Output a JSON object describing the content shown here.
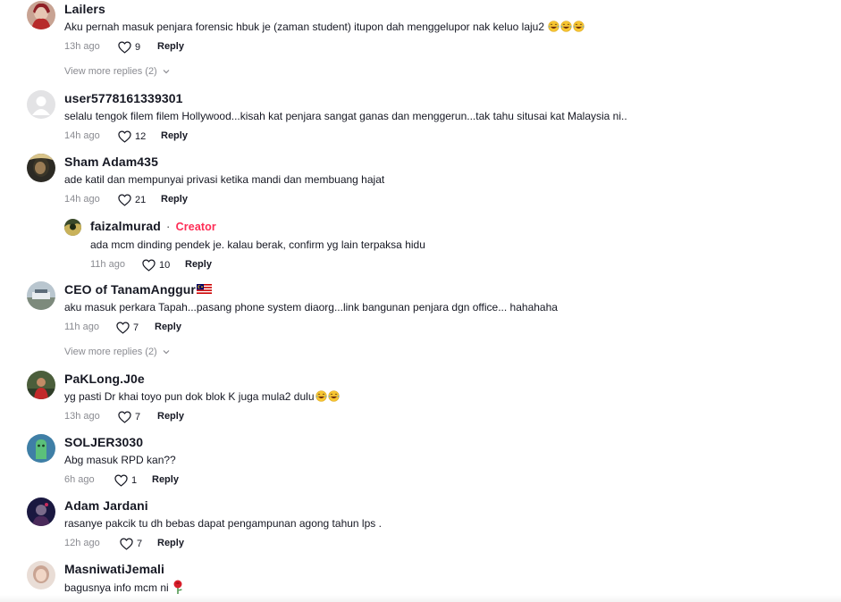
{
  "icons": {
    "like": "heart-outline-icon",
    "chevron": "chevron-down-icon",
    "laugh": "face-with-tears-of-joy-emoji",
    "flag": "malaysia-flag-emoji",
    "rose": "rose-emoji"
  },
  "colors": {
    "creator": "#fe2c55",
    "meta": "#8a8b91",
    "text": "#161823"
  },
  "comments": [
    {
      "username": "Lailers",
      "text": "Aku pernah masuk penjara forensic hbuk je (zaman student) itupon dah menggelupor nak keluo laju2",
      "time": "13h ago",
      "likes": "9",
      "reply_label": "Reply",
      "view_more": "View more replies (2)"
    },
    {
      "username": "user5778161339301",
      "text": "selalu tengok filem filem Hollywood...kisah kat penjara sangat ganas dan menggerun...tak tahu situsai kat Malaysia ni..",
      "time": "14h ago",
      "likes": "12",
      "reply_label": "Reply"
    },
    {
      "username": "Sham Adam435",
      "text": "ade katil dan mempunyai privasi ketika mandi dan membuang hajat",
      "time": "14h ago",
      "likes": "21",
      "reply_label": "Reply",
      "replies": [
        {
          "username": "faizalmurad",
          "separator": "·",
          "badge": "Creator",
          "text": "ada mcm dinding pendek je. kalau berak, confirm yg lain terpaksa hidu",
          "time": "11h ago",
          "likes": "10",
          "reply_label": "Reply"
        }
      ]
    },
    {
      "username": "CEO of TanamAnggur",
      "text": "aku masuk perkara Tapah...pasang phone system diaorg...link bangunan penjara dgn office... hahahaha",
      "time": "11h ago",
      "likes": "7",
      "reply_label": "Reply",
      "view_more": "View more replies (2)"
    },
    {
      "username": "PaKLong.J0e",
      "text": "yg pasti Dr khai toyo pun dok blok K juga mula2 dulu",
      "time": "13h ago",
      "likes": "7",
      "reply_label": "Reply"
    },
    {
      "username": "SOLJER3030",
      "text": "Abg masuk RPD kan??",
      "time": "6h ago",
      "likes": "1",
      "reply_label": "Reply"
    },
    {
      "username": "Adam Jardani",
      "text": "rasanye pakcik tu dh bebas dapat pengampunan agong tahun lps .",
      "time": "12h ago",
      "likes": "7",
      "reply_label": "Reply"
    },
    {
      "username": "MasniwatiJemali",
      "text": "bagusnya info mcm ni",
      "time": "",
      "likes": "",
      "reply_label": ""
    }
  ]
}
